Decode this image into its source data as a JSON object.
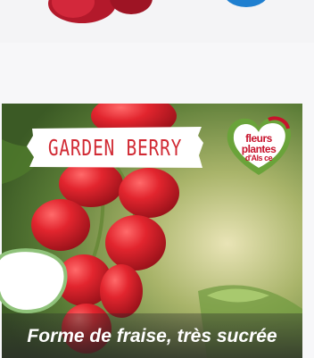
{
  "product": {
    "name": "GARDEN BERRY",
    "tagline": "Forme de fraise, très sucrée"
  },
  "logo": {
    "line1": "fleurs",
    "line2": "plantes",
    "line3": "d'Als ce"
  },
  "colors": {
    "title_red": "#d12a34",
    "logo_red": "#c7132c",
    "logo_green": "#6aa33a",
    "top_badge_blue": "#1f7fd0"
  },
  "icons": [
    "heart-logo-icon",
    "shopping-badge-icon"
  ]
}
